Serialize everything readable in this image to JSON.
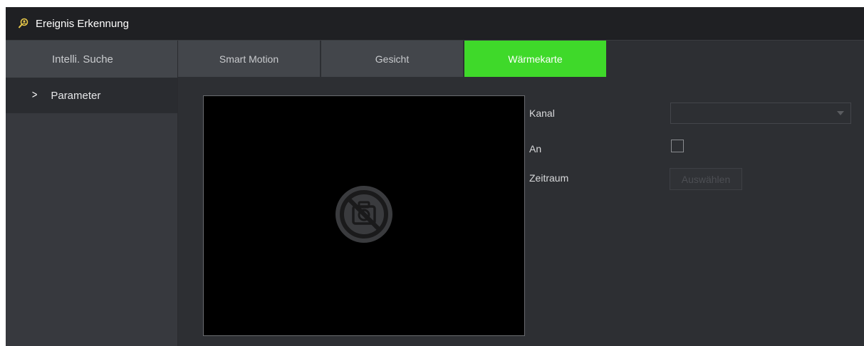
{
  "titlebar": {
    "title": "Ereignis Erkennung",
    "icon": "person-search-icon"
  },
  "sidebar": {
    "header": "Intelli. Suche",
    "items": [
      {
        "label": "Parameter",
        "chevron": "chevron-right-icon",
        "selected": true
      }
    ]
  },
  "tabs": [
    {
      "label": "Smart Motion",
      "active": false
    },
    {
      "label": "Gesicht",
      "active": false
    },
    {
      "label": "Wärmekarte",
      "active": true
    }
  ],
  "video": {
    "placeholder_icon": "no-camera-icon"
  },
  "form": {
    "channel_label": "Kanal",
    "channel_value": "",
    "enable_label": "An",
    "enable_checked": false,
    "period_label": "Zeitraum",
    "period_button": "Auswählen"
  },
  "colors": {
    "accent": "#3fd92a",
    "background": "#2d2f33",
    "titlebar": "#1f2023",
    "sidebar": "#37393e"
  }
}
